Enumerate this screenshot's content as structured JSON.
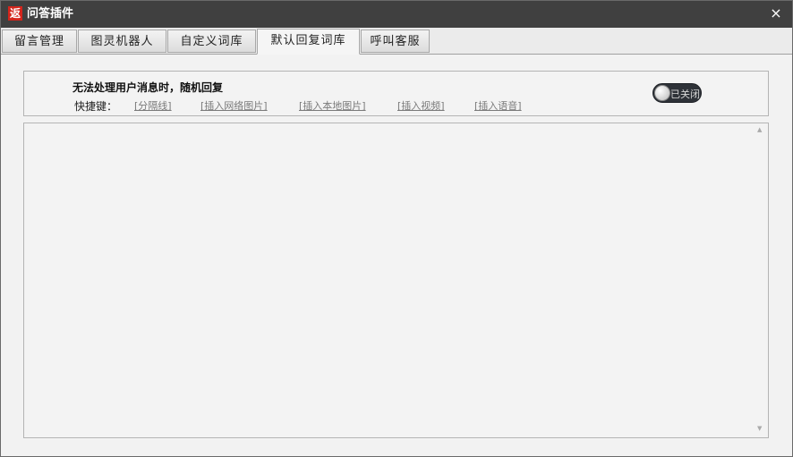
{
  "window": {
    "icon_char": "返",
    "title": "问答插件",
    "close_symbol": "×"
  },
  "tabs": [
    {
      "label": "留言管理",
      "active": false
    },
    {
      "label": "图灵机器人",
      "active": false
    },
    {
      "label": "自定义词库",
      "active": false
    },
    {
      "label": "默认回复词库",
      "active": true
    },
    {
      "label": "呼叫客服",
      "active": false
    }
  ],
  "options": {
    "title": "无法处理用户消息时，随机回复",
    "shortcut_label": "快捷键：",
    "shortcuts": [
      "[分隔线]",
      "[插入网络图片]",
      "[插入本地图片]",
      "[插入视频]",
      "[插入语音]"
    ],
    "toggle": {
      "text": "已关闭",
      "state": "off"
    }
  },
  "editor": {
    "value": "",
    "scroll_up_symbol": "▲",
    "scroll_down_symbol": "▼"
  },
  "colors": {
    "titlebar": "#404040",
    "app_icon": "#d4251c",
    "toggle_bg": "#2e3238",
    "link": "#7a7a7a"
  }
}
